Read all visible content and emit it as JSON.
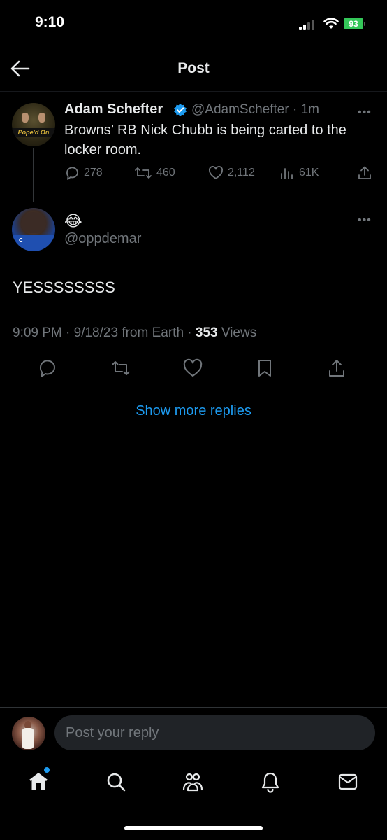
{
  "status_bar": {
    "time": "9:10",
    "battery": "93"
  },
  "header": {
    "title": "Post",
    "back_icon": "arrow-left-icon"
  },
  "quoted_post": {
    "author_name": "Adam Schefter",
    "verified": true,
    "handle": "@AdamSchefter",
    "separator": "·",
    "time": "1m",
    "text": "Browns’ RB Nick Chubb is being carted to the locker room.",
    "avatar_text": "Pope'd On",
    "stats": {
      "replies": "278",
      "reposts": "460",
      "likes": "2,112",
      "views": "61K"
    }
  },
  "reply_post": {
    "emoji": "😂",
    "handle": "@oppdemar",
    "avatar_text": "C",
    "text": "YESSSSSSSS",
    "meta_prefix": "9:09 PM · 9/18/23 from Earth · ",
    "views_count": "353",
    "views_label": " Views"
  },
  "show_more": "Show more replies",
  "reply_bar": {
    "placeholder": "Post your reply"
  },
  "nav": [
    "home-icon",
    "search-icon",
    "communities-icon",
    "notifications-icon",
    "messages-icon"
  ],
  "colors": {
    "background": "#000000",
    "accent": "#1d9bf0",
    "muted": "#71767b",
    "battery": "#34c759"
  }
}
